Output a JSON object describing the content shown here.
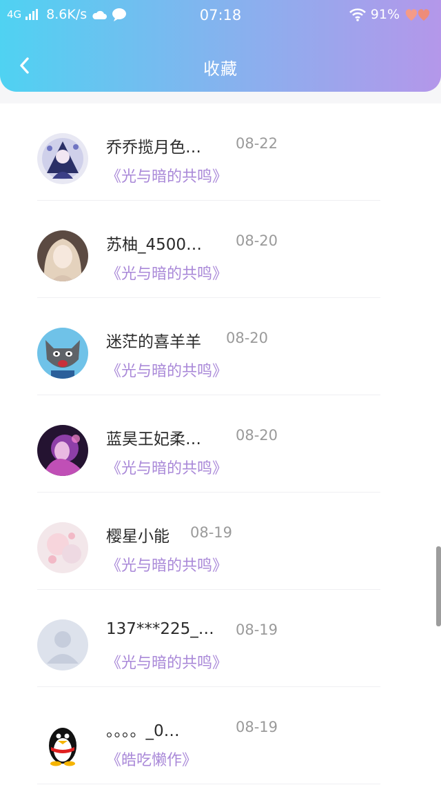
{
  "status_bar": {
    "network": "4G",
    "speed": "8.6K/s",
    "time": "07:18",
    "battery": "91%"
  },
  "header": {
    "title": "收藏"
  },
  "colors": {
    "header_gradient_start": "#4fd2f2",
    "header_gradient_end": "#b497ea",
    "work_title": "#a988d8",
    "date": "#9a9a9a"
  },
  "favorites": [
    {
      "name": "乔乔揽月色…",
      "date": "08-22",
      "work": "《光与暗的共鸣》",
      "avatar": "anime-dark-avatar"
    },
    {
      "name": "苏柚_4500…",
      "date": "08-20",
      "work": "《光与暗的共鸣》",
      "avatar": "anime-girl-avatar"
    },
    {
      "name": "迷茫的喜羊羊",
      "date": "08-20",
      "work": "《光与暗的共鸣》",
      "avatar": "grey-wolf-avatar"
    },
    {
      "name": "蓝昊王妃柔…",
      "date": "08-20",
      "work": "《光与暗的共鸣》",
      "avatar": "purple-girl-avatar"
    },
    {
      "name": "樱星小能",
      "date": "08-19",
      "work": "《光与暗的共鸣》",
      "avatar": "pastel-avatar"
    },
    {
      "name": "137***225_…",
      "date": "08-19",
      "work": "《光与暗的共鸣》",
      "avatar": "default-user-avatar"
    },
    {
      "name": "。。。。_0…",
      "date": "08-19",
      "work": "《皓吃懒作》",
      "avatar": "qq-penguin-avatar"
    }
  ]
}
